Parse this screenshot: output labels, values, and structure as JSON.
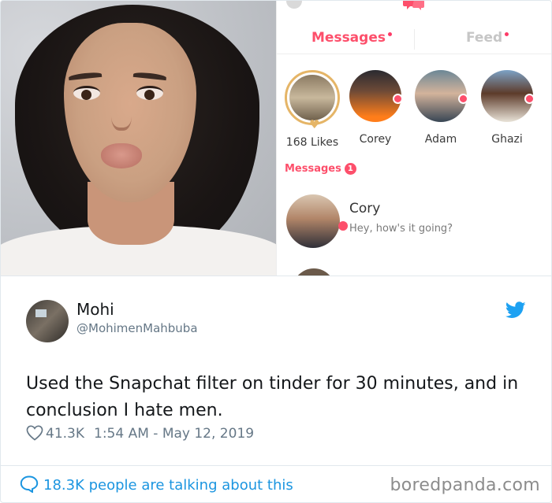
{
  "screenshot": {
    "tinder": {
      "tabs": [
        {
          "label": "Messages"
        },
        {
          "label": "Feed"
        }
      ],
      "matches": [
        {
          "name": "168 Likes"
        },
        {
          "name": "Corey"
        },
        {
          "name": "Adam"
        },
        {
          "name": "Ghazi"
        }
      ],
      "messages_label": "Messages",
      "messages_count": "1",
      "conversation": {
        "name": "Cory",
        "preview": "Hey, how's it going?"
      }
    }
  },
  "tweet": {
    "user_name": "Mohi",
    "handle": "@MohimenMahbuba",
    "text": "Used the Snapchat filter on tinder for 30 minutes, and in conclusion I hate men.",
    "likes": "41.3K",
    "timestamp": "1:54 AM - May 12, 2019",
    "talking": "18.3K people are talking about this"
  },
  "watermark": "boredpanda.com",
  "colors": {
    "tinder_accent": "#fd4f6b",
    "likes_gold": "#e5b567",
    "twitter_blue": "#1da1f2",
    "link_blue": "#1b95e0"
  },
  "icons": [
    "twitter-bird-icon",
    "heart-icon",
    "speech-bubble-icon",
    "chat-logo-icon"
  ]
}
